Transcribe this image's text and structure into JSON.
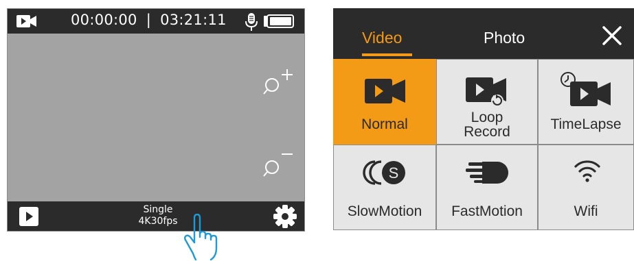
{
  "camera_screen": {
    "recorded_time": "00:00:00",
    "separator": "|",
    "remaining_time": "03:21:11",
    "mode_line1": "Single",
    "mode_line2": "4K30fps"
  },
  "menu": {
    "tabs": [
      {
        "label": "Video",
        "active": true
      },
      {
        "label": "Photo",
        "active": false
      }
    ],
    "items": [
      {
        "label": "Normal",
        "active": true,
        "icon": "video-camera-icon"
      },
      {
        "label_line1": "Loop",
        "label_line2": "Record",
        "active": false,
        "icon": "loop-record-icon"
      },
      {
        "label": "TimeLapse",
        "active": false,
        "icon": "timelapse-icon"
      },
      {
        "label": "SlowMotion",
        "active": false,
        "icon": "slow-motion-icon"
      },
      {
        "label": "FastMotion",
        "active": false,
        "icon": "fast-motion-icon"
      },
      {
        "label": "Wifi",
        "active": false,
        "icon": "wifi-icon"
      }
    ]
  },
  "colors": {
    "accent": "#f39a17",
    "bar": "#2b2b2b",
    "preview": "#a3a3a3",
    "cell": "#e6e6e6"
  }
}
